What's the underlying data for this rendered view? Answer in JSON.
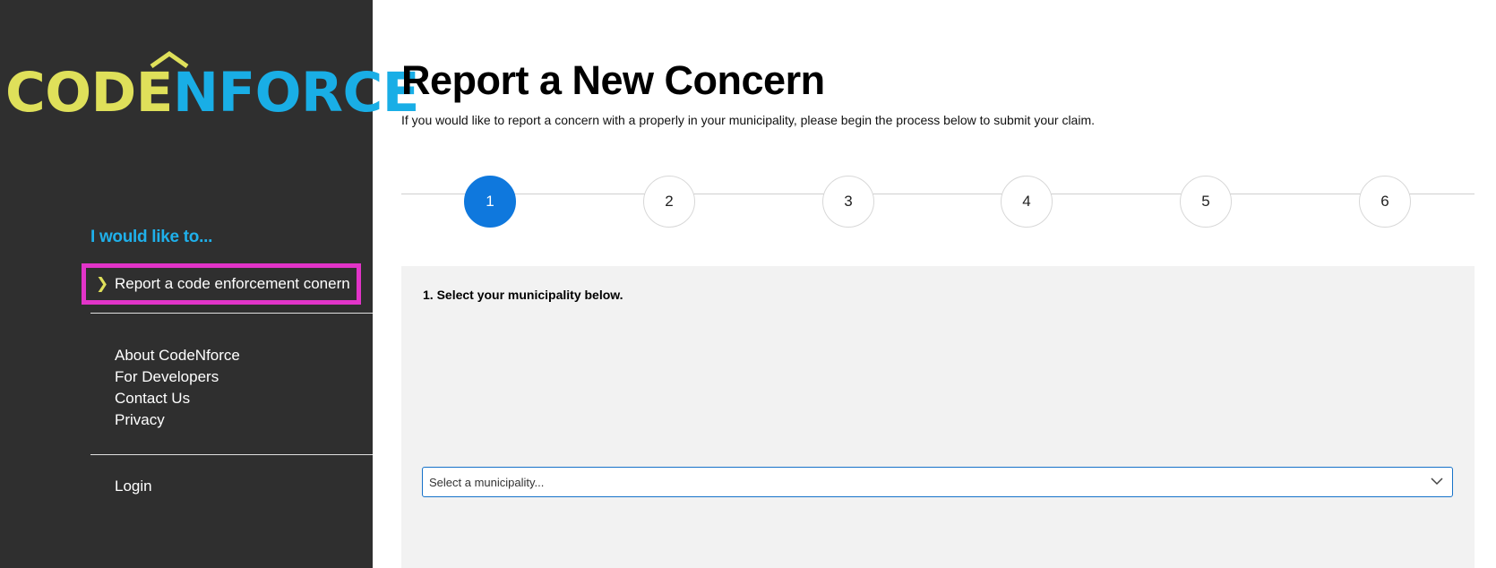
{
  "sidebar": {
    "logo": {
      "part1": "CODE",
      "part2": "N",
      "part3": "FORCE"
    },
    "heading": "I would like to...",
    "active_item": {
      "label": "Report a code enforcement conern",
      "icon": "chevron-right-icon"
    },
    "links": [
      "About CodeNforce",
      "For Developers",
      "Contact Us",
      "Privacy"
    ],
    "login": "Login"
  },
  "main": {
    "title": "Report a New Concern",
    "description": "If you would like to report a concern with a properly in your municipality, please begin the process below to submit your claim.",
    "steps": [
      "1",
      "2",
      "3",
      "4",
      "5",
      "6"
    ],
    "active_step": 1,
    "panel": {
      "prompt": "1. Select your municipality below.",
      "select_placeholder": "Select a municipality...",
      "select_icon": "chevron-down-icon"
    }
  },
  "colors": {
    "sidebar_bg": "#2f2f2f",
    "logo_yellow": "#dfe05a",
    "logo_blue": "#19aee6",
    "heading_blue": "#1fb0ea",
    "highlight_magenta": "#e234c8",
    "step_active": "#0f78dd",
    "panel_bg": "#f2f2f2"
  }
}
